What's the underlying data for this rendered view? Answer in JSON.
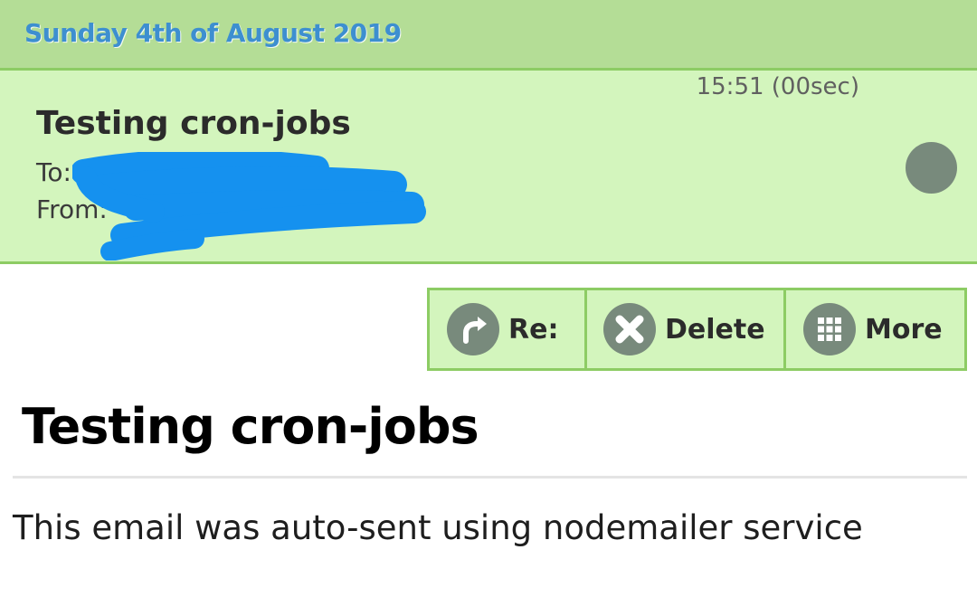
{
  "date_header": "Sunday 4th of August 2019",
  "message": {
    "time": "15:51 (00sec)",
    "subject": "Testing cron-jobs",
    "to_label": "To:",
    "from_label": "From:",
    "status_icon": "unread-dot-icon"
  },
  "toolbar": {
    "reply_label": "Re:",
    "delete_label": "Delete",
    "more_label": "More",
    "reply_icon": "reply-arrow-icon",
    "delete_icon": "close-x-icon",
    "more_icon": "grid-icon"
  },
  "email_body": {
    "title": "Testing cron-jobs",
    "text": "This email was auto-sent using nodemailer service"
  },
  "colors": {
    "date_bar_bg": "#b4dd96",
    "date_text": "#3d8fd0",
    "message_bg": "#d3f5bd",
    "border": "#8dcc64",
    "icon_bg": "#788a7c",
    "redaction": "#1591ef"
  }
}
